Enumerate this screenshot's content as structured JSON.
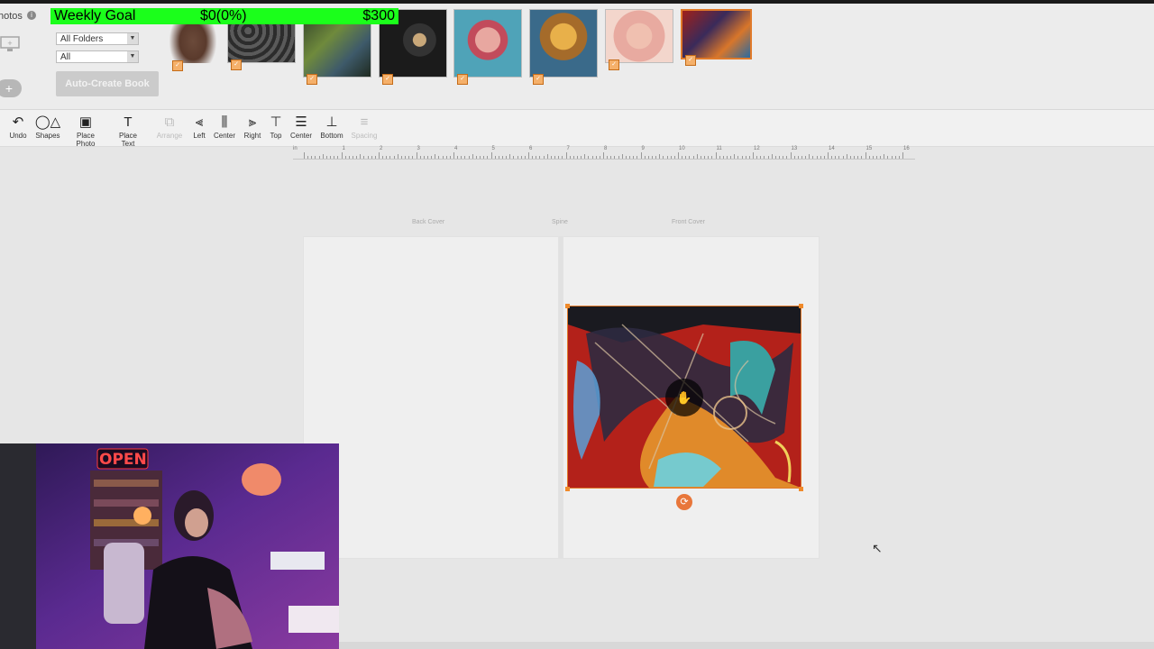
{
  "photos_panel": {
    "label": "hotos",
    "folder_select": "All Folders",
    "filter_select": "All",
    "auto_create_label": "Auto-Create Book"
  },
  "goal": {
    "title": "Weekly Goal",
    "current": "$0(0%)",
    "target": "$300"
  },
  "toolbar": {
    "items": [
      {
        "label": "Undo",
        "icon": "undo-icon"
      },
      {
        "label": "Shapes",
        "icon": "shapes-icon"
      },
      {
        "label": "Place Photo",
        "icon": "photo-icon"
      },
      {
        "label": "Place Text",
        "icon": "text-icon"
      },
      {
        "label": "Arrange",
        "icon": "arrange-icon"
      },
      {
        "label": "Left",
        "icon": "align-left-icon"
      },
      {
        "label": "Center",
        "icon": "align-center-icon"
      },
      {
        "label": "Right",
        "icon": "align-right-icon"
      },
      {
        "label": "Top",
        "icon": "align-top-icon"
      },
      {
        "label": "Center",
        "icon": "align-middle-icon"
      },
      {
        "label": "Bottom",
        "icon": "align-bottom-icon"
      },
      {
        "label": "Spacing",
        "icon": "spacing-icon"
      }
    ]
  },
  "ruler": {
    "unit": "in",
    "numbers": [
      "1",
      "2",
      "3",
      "4",
      "5",
      "6",
      "7",
      "8",
      "9",
      "10",
      "11",
      "12",
      "13",
      "14",
      "15",
      "16"
    ]
  },
  "canvas": {
    "back_cover": "Back Cover",
    "spine": "Spine",
    "front_cover": "Front Cover"
  },
  "webcam": {
    "sign_text": "OPEN"
  },
  "colors": {
    "accent": "#e07a2a",
    "goal_green": "#1bff1b"
  }
}
